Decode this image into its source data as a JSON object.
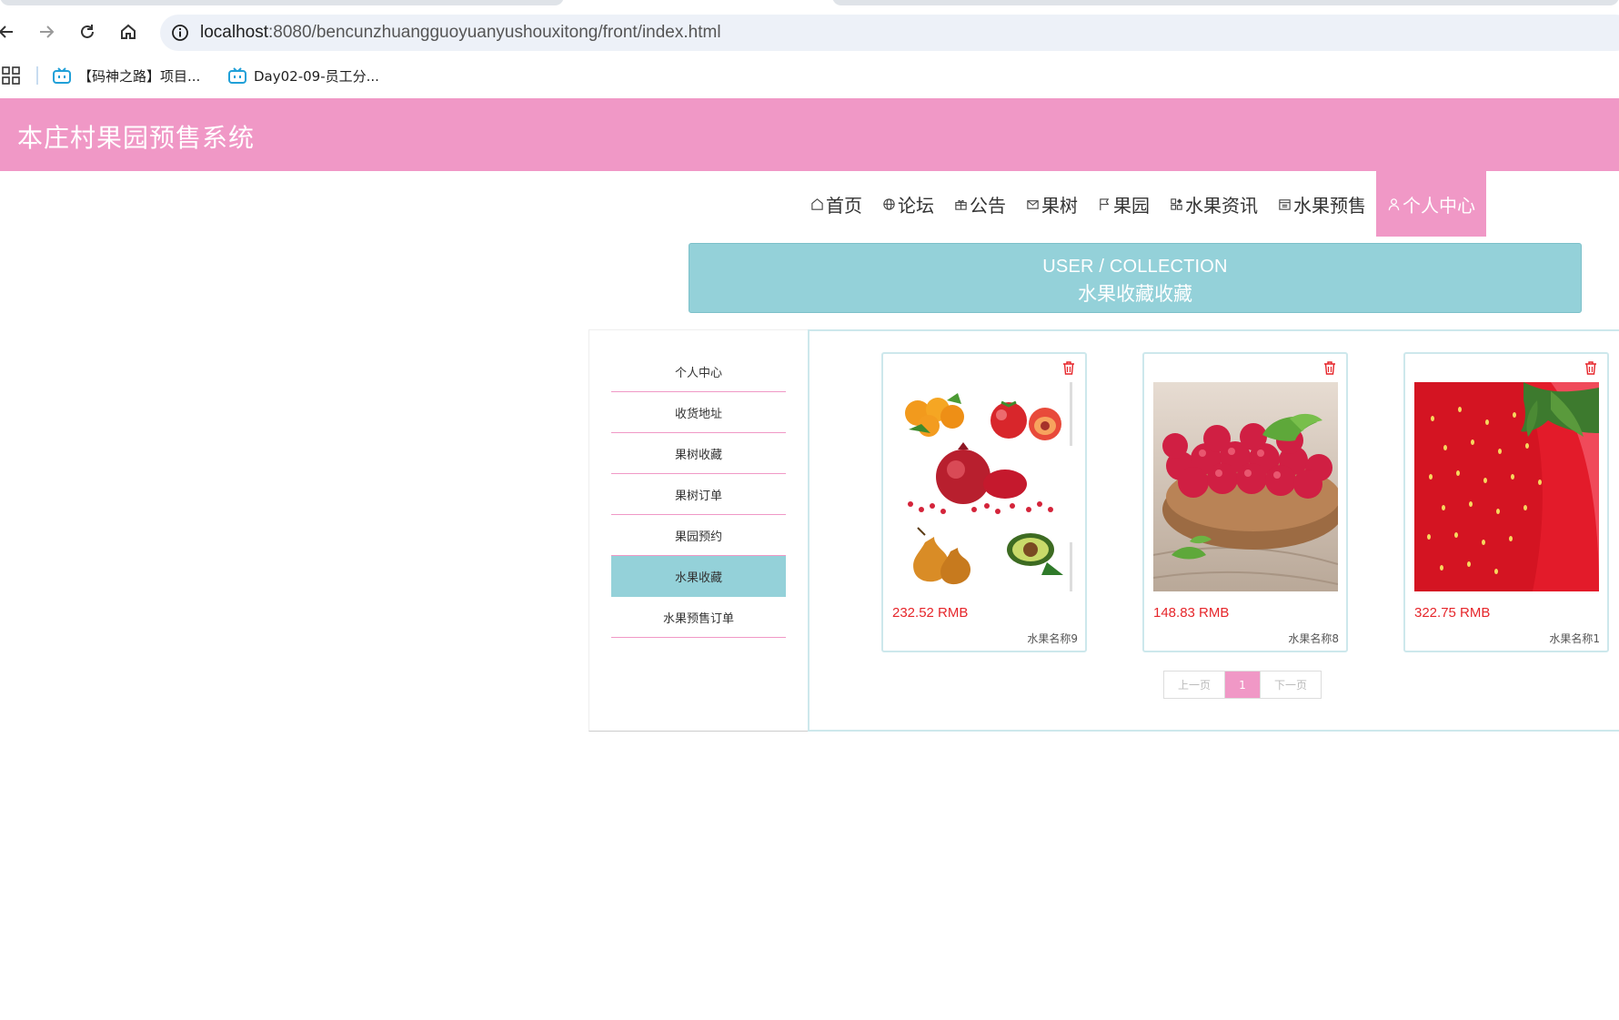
{
  "browser": {
    "url_host": "localhost",
    "url_rest": ":8080/bencunzhuangguoyuanyushouxitong/front/index.html",
    "bookmarks": [
      {
        "label": "【码神之路】项目...",
        "icon": "bilibili-icon"
      },
      {
        "label": "Day02-09-员工分...",
        "icon": "bilibili-icon"
      }
    ]
  },
  "header": {
    "title": "本庄村果园预售系统"
  },
  "nav": [
    {
      "label": "首页",
      "icon": "home-icon"
    },
    {
      "label": "论坛",
      "icon": "globe-icon"
    },
    {
      "label": "公告",
      "icon": "gift-icon"
    },
    {
      "label": "果树",
      "icon": "mail-icon"
    },
    {
      "label": "果园",
      "icon": "flag-icon"
    },
    {
      "label": "水果资讯",
      "icon": "apps-icon"
    },
    {
      "label": "水果预售",
      "icon": "calendar-icon"
    },
    {
      "label": "个人中心",
      "icon": "user-icon",
      "active": true
    }
  ],
  "banner": {
    "en": "USER / COLLECTION",
    "cn": "水果收藏收藏"
  },
  "sidebar": [
    {
      "label": "个人中心"
    },
    {
      "label": "收货地址"
    },
    {
      "label": "果树收藏"
    },
    {
      "label": "果树订单"
    },
    {
      "label": "果园预约"
    },
    {
      "label": "水果收藏",
      "active": true
    },
    {
      "label": "水果预售订单"
    }
  ],
  "cards": [
    {
      "price": "232.52 RMB",
      "name": "水果名称9",
      "image": "mixed-fruits-image"
    },
    {
      "price": "148.83 RMB",
      "name": "水果名称8",
      "image": "raspberries-image"
    },
    {
      "price": "322.75 RMB",
      "name": "水果名称1",
      "image": "strawberry-image"
    }
  ],
  "pager": {
    "prev": "上一页",
    "current": "1",
    "next": "下一页"
  },
  "colors": {
    "brand_pink": "#f098c6",
    "accent_teal": "#94d1d9",
    "price_red": "#e6262b"
  }
}
